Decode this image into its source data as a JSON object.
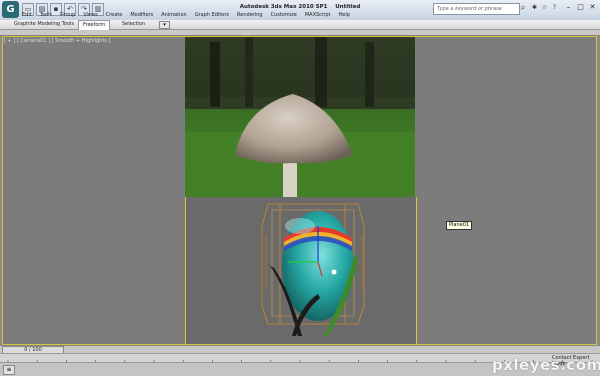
{
  "app": {
    "logo_letter": "G",
    "title": "Autodesk 3ds Max  2010 SP1",
    "document": "Untitled",
    "search_placeholder": "Type a keyword or phrase"
  },
  "menu": [
    "Edit",
    "Tools",
    "Group",
    "Views",
    "Create",
    "Modifiers",
    "Animation",
    "Graph Editors",
    "Rendering",
    "Customize",
    "MAXScript",
    "Help"
  ],
  "ribbon_tabs": [
    "Graphite Modeling Tools",
    "Freeform",
    "Selection"
  ],
  "viewport": {
    "label": "[ + ] [ Camera01 ] [ Smooth + Highlights ]",
    "tooltip": "Plane01"
  },
  "timeline": {
    "frame_readout": "0 / 100",
    "ruler_ticks": [
      "0",
      "5",
      "10",
      "15",
      "20",
      "25",
      "30",
      "35",
      "40",
      "45",
      "50",
      "55",
      "60",
      "65",
      "70",
      "75",
      "80",
      "85",
      "90",
      "95",
      "100"
    ]
  },
  "status": {
    "right_text": "Contact Expert Mode"
  },
  "watermark": "pxleyes.com",
  "colors": {
    "viewport_border": "#d9c33c",
    "egg": "#2aa8a8",
    "cage": "#d08a2a"
  }
}
